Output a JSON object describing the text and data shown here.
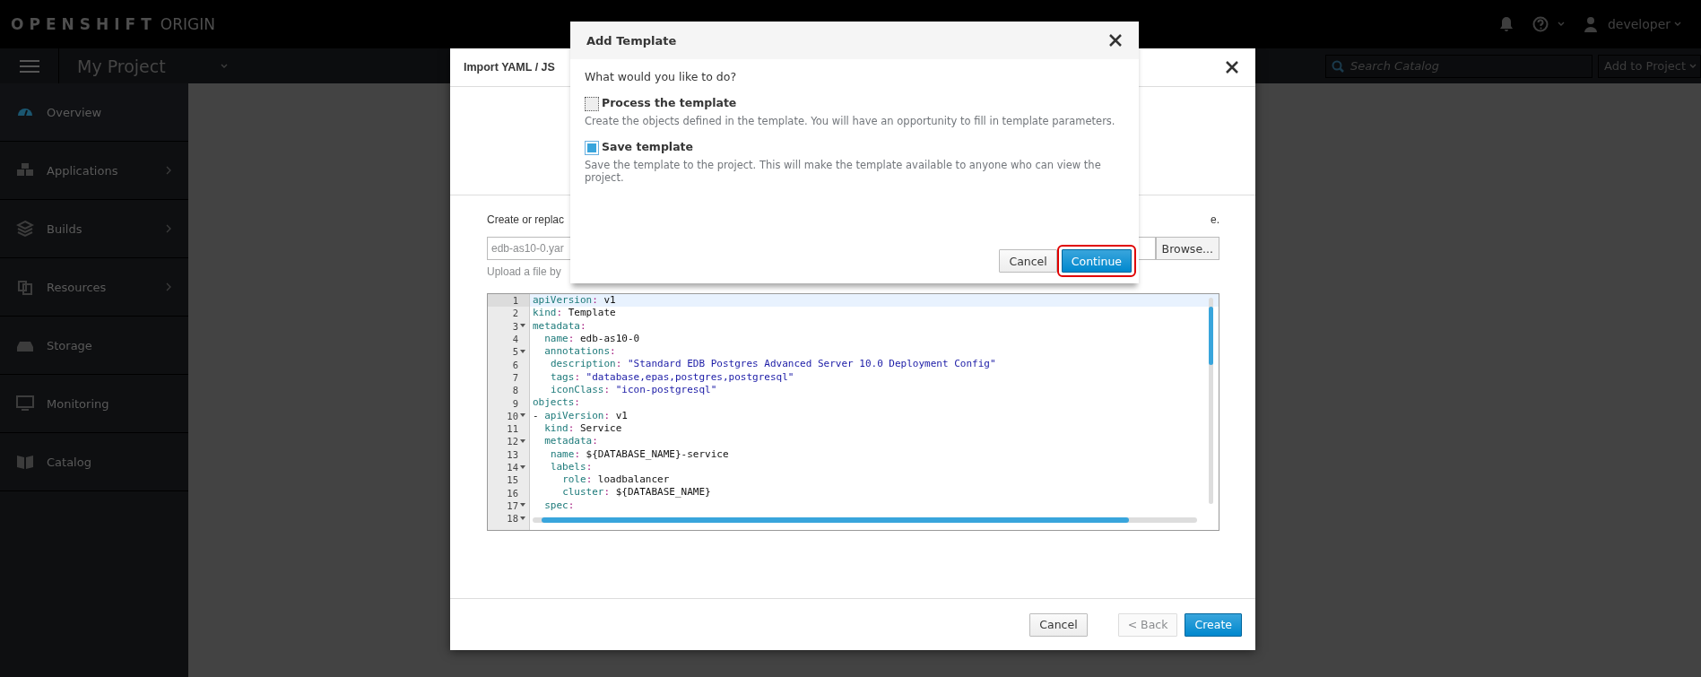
{
  "topbar": {
    "brand_bold": "OPENSHIFT",
    "brand_light": "ORIGIN",
    "user": "developer"
  },
  "navbar": {
    "project": "My Project",
    "search": {
      "placeholder": "Search Catalog"
    },
    "add_button": "Add to Project"
  },
  "sidebar": {
    "items": [
      {
        "label": "Overview",
        "selected": true,
        "has_submenu": false
      },
      {
        "label": "Applications",
        "selected": false,
        "has_submenu": true
      },
      {
        "label": "Builds",
        "selected": false,
        "has_submenu": true
      },
      {
        "label": "Resources",
        "selected": false,
        "has_submenu": true
      },
      {
        "label": "Storage",
        "selected": false,
        "has_submenu": false
      },
      {
        "label": "Monitoring",
        "selected": false,
        "has_submenu": false
      },
      {
        "label": "Catalog",
        "selected": false,
        "has_submenu": false
      }
    ]
  },
  "import_dialog": {
    "title": "Import YAML / JS",
    "intro_start": "Create or replac",
    "intro_end": "e.",
    "file_field": {
      "value": "edb-as10-0.yar"
    },
    "browse_button": "Browse...",
    "upload_hint": "Upload a file by",
    "editor": {
      "lines": [
        {
          "number": "1",
          "fold": false,
          "active": true,
          "code": "apiVersion: v1"
        },
        {
          "number": "2",
          "fold": false,
          "active": false,
          "code": "kind: Template"
        },
        {
          "number": "3",
          "fold": true,
          "active": false,
          "code": "metadata:"
        },
        {
          "number": "4",
          "fold": false,
          "active": false,
          "code": "  name: edb-as10-0"
        },
        {
          "number": "5",
          "fold": true,
          "active": false,
          "code": "  annotations:"
        },
        {
          "number": "6",
          "fold": false,
          "active": false,
          "code": "   description: \"Standard EDB Postgres Advanced Server 10.0 Deployment Config\""
        },
        {
          "number": "7",
          "fold": false,
          "active": false,
          "code": "   tags: \"database,epas,postgres,postgresql\""
        },
        {
          "number": "8",
          "fold": false,
          "active": false,
          "code": "   iconClass: \"icon-postgresql\""
        },
        {
          "number": "9",
          "fold": false,
          "active": false,
          "code": "objects:"
        },
        {
          "number": "10",
          "fold": true,
          "active": false,
          "code": "- apiVersion: v1"
        },
        {
          "number": "11",
          "fold": false,
          "active": false,
          "code": "  kind: Service"
        },
        {
          "number": "12",
          "fold": true,
          "active": false,
          "code": "  metadata:"
        },
        {
          "number": "13",
          "fold": false,
          "active": false,
          "code": "   name: ${DATABASE_NAME}-service"
        },
        {
          "number": "14",
          "fold": true,
          "active": false,
          "code": "   labels:"
        },
        {
          "number": "15",
          "fold": false,
          "active": false,
          "code": "     role: loadbalancer"
        },
        {
          "number": "16",
          "fold": false,
          "active": false,
          "code": "     cluster: ${DATABASE_NAME}"
        },
        {
          "number": "17",
          "fold": true,
          "active": false,
          "code": "  spec:"
        },
        {
          "number": "18",
          "fold": true,
          "active": false
        }
      ]
    },
    "buttons": [
      {
        "label": "Cancel",
        "kind": "default",
        "disabled": false
      },
      {
        "label": "< Back",
        "kind": "default",
        "disabled": true
      },
      {
        "label": "Create",
        "kind": "primary",
        "disabled": false
      }
    ]
  },
  "add_template_dialog": {
    "title": "Add Template",
    "question": "What would you like to do?",
    "options": [
      {
        "label": "Process the template",
        "description": "Create the objects defined in the template. You will have an opportunity to fill in template parameters.",
        "checked": false
      },
      {
        "label": "Save template",
        "description": "Save the template to the project. This will make the template available to anyone who can view the project.",
        "checked": true
      }
    ],
    "buttons": [
      {
        "label": "Cancel",
        "kind": "default",
        "highlighted": false
      },
      {
        "label": "Continue",
        "kind": "primary",
        "highlighted": true
      }
    ]
  }
}
